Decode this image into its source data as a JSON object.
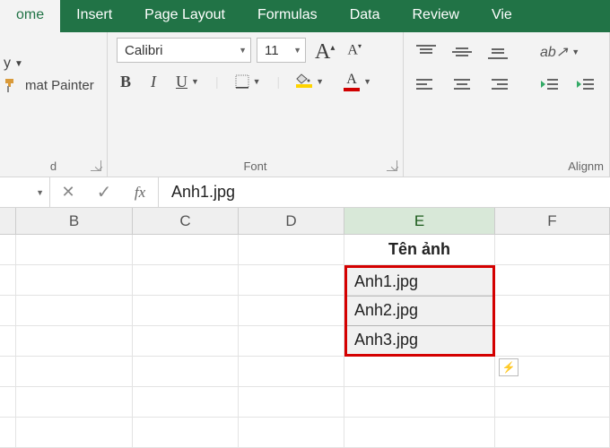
{
  "tabs": {
    "home": "ome",
    "insert": "Insert",
    "pageLayout": "Page Layout",
    "formulas": "Formulas",
    "data": "Data",
    "review": "Review",
    "view": "Vie"
  },
  "clipboard": {
    "copy": "y",
    "formatPainter": "mat Painter",
    "label": "d"
  },
  "font": {
    "name": "Calibri",
    "size": "11",
    "bold": "B",
    "italic": "I",
    "underline": "U",
    "fontColorLetter": "A",
    "label": "Font"
  },
  "alignment": {
    "label": "Alignm"
  },
  "formulaBar": {
    "fx": "fx",
    "value": "Anh1.jpg"
  },
  "columns": {
    "B": "B",
    "C": "C",
    "D": "D",
    "E": "E",
    "F": "F"
  },
  "sheet": {
    "headerE": "Tên ảnh",
    "e2": "Anh1.jpg",
    "e3": "Anh2.jpg",
    "e4": "Anh3.jpg"
  },
  "colWidths": {
    "lead": 18,
    "B": 130,
    "C": 118,
    "D": 118,
    "E": 168,
    "F": 128
  }
}
